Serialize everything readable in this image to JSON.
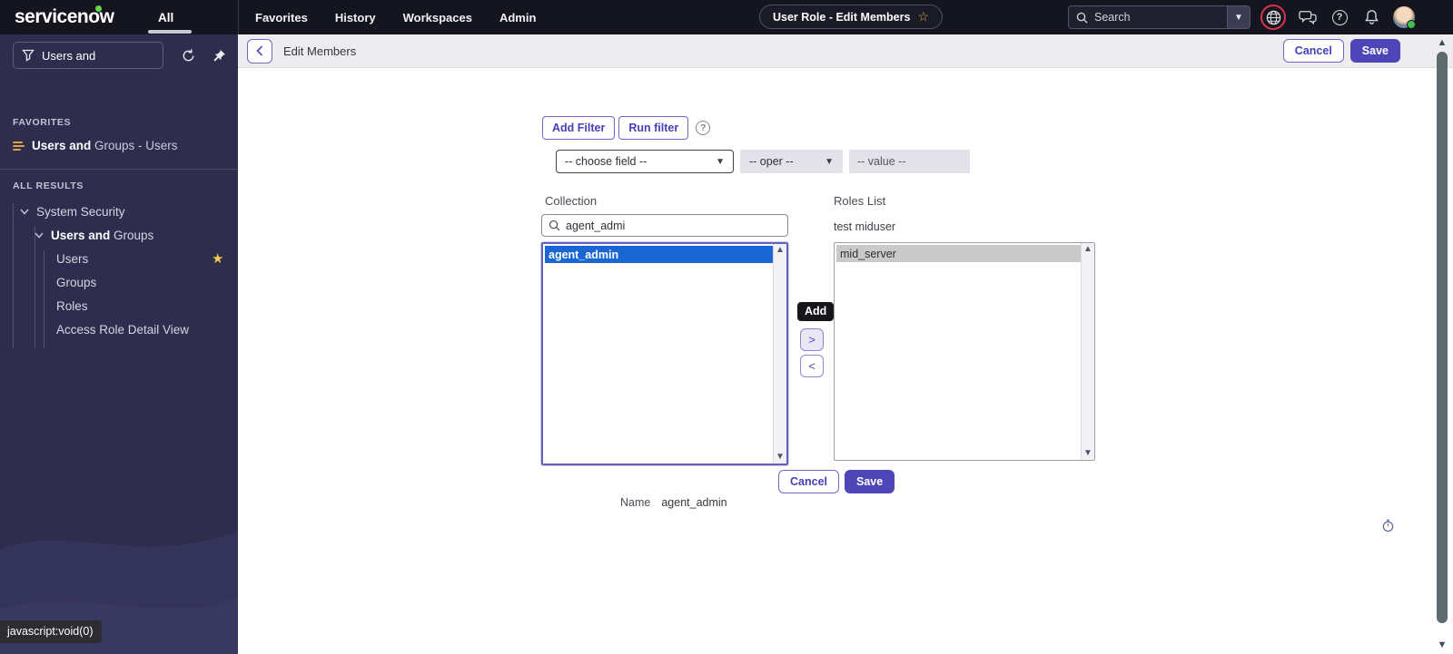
{
  "header": {
    "logo": "servicenow",
    "all_tab": "All",
    "nav": [
      {
        "label": "Favorites"
      },
      {
        "label": "History"
      },
      {
        "label": "Workspaces"
      },
      {
        "label": "Admin"
      }
    ],
    "context_pill": "User Role - Edit Members",
    "search_placeholder": "Search"
  },
  "sidebar": {
    "filter_value": "Users and",
    "favorites_label": "FAVORITES",
    "favorite_item": {
      "bold": "Users and",
      "rest": " Groups - Users"
    },
    "all_results_label": "ALL RESULTS",
    "tree": [
      {
        "label": "System Security"
      },
      {
        "bold": "Users and",
        "rest": " Groups"
      },
      {
        "label": "Users"
      },
      {
        "label": "Groups"
      },
      {
        "label": "Roles"
      },
      {
        "label": "Access Role Detail View"
      }
    ],
    "status_link": "javascript:void(0)"
  },
  "page_header": {
    "title": "Edit Members",
    "cancel_label": "Cancel",
    "save_label": "Save"
  },
  "filter": {
    "add_filter_label": "Add Filter",
    "run_filter_label": "Run filter",
    "choose_field": "-- choose field --",
    "oper": "-- oper --",
    "value": "-- value --"
  },
  "slushbucket": {
    "left_label": "Collection",
    "left_search_value": "agent_admi",
    "left_items": [
      {
        "label": "agent_admin",
        "selected": true
      }
    ],
    "right_label": "Roles List",
    "right_subtitle": "test miduser",
    "right_items": [
      {
        "label": "mid_server",
        "selected": true
      }
    ],
    "add_tooltip": "Add",
    "cancel_label": "Cancel",
    "save_label": "Save",
    "name_label": "Name",
    "name_value": "agent_admin"
  },
  "icons": {
    "caret_down": "▾",
    "select_caret": "▼",
    "scroll_up": "▲",
    "scroll_down": "▼",
    "star_filled": "★",
    "star_outline": "☆",
    "help_glyph": "?",
    "move_right": ">",
    "move_left": "<"
  },
  "colors": {
    "topbar_bg": "#15151f",
    "sidebar_bg": "#2e2d4d",
    "accent_indigo": "#4e46b8",
    "selected_blue": "#1a66d2",
    "selected_gray": "#c9c9c9",
    "favorite_star": "#f2c94c",
    "annotation_ring_red": "#d8344b",
    "logo_green": "#62d84e"
  }
}
